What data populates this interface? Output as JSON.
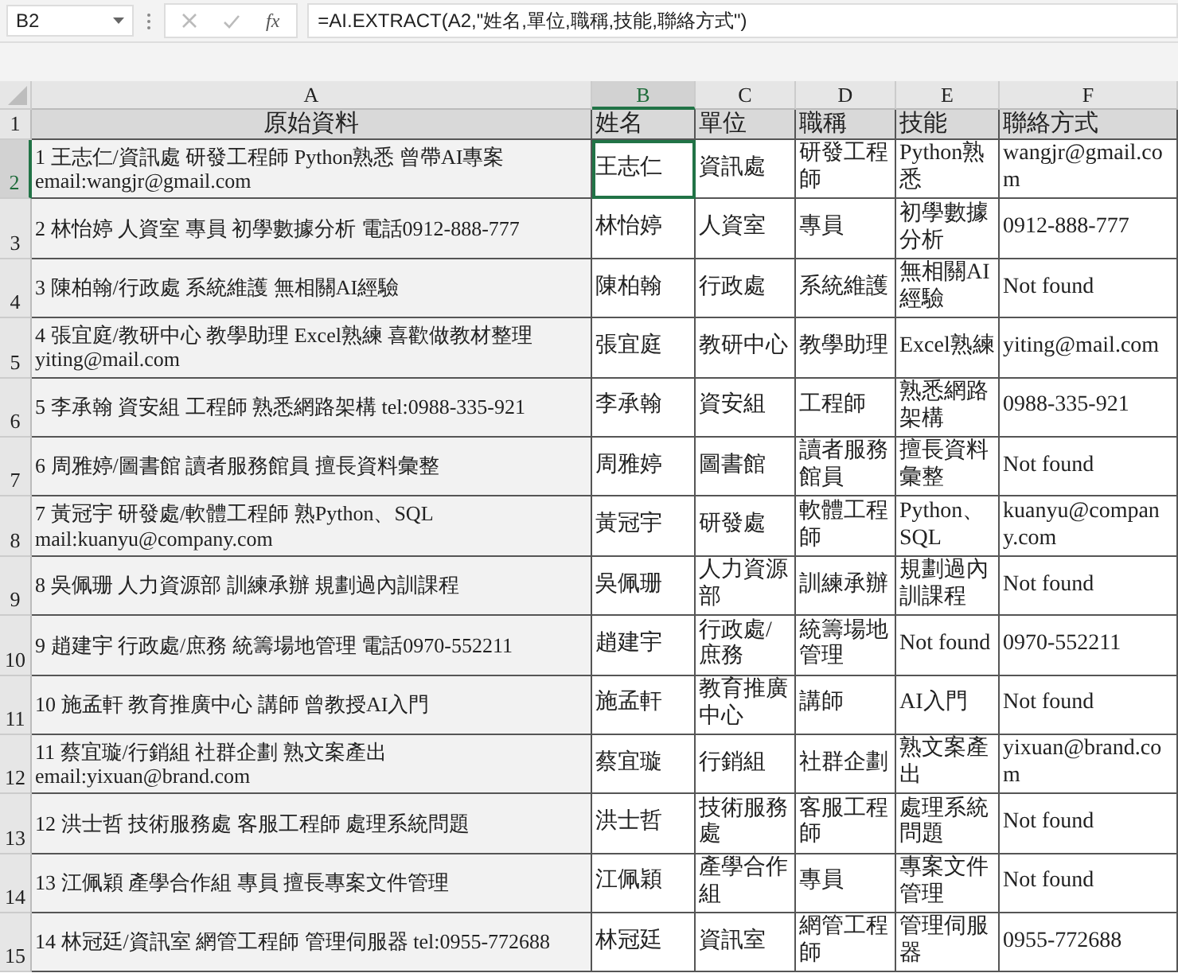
{
  "formula_bar": {
    "name_box": "B2",
    "function_label": "fx",
    "formula": "=AI.EXTRACT(A2,\"姓名,單位,職稱,技能,聯絡方式\")"
  },
  "columns": [
    {
      "label": "A",
      "selected": false
    },
    {
      "label": "B",
      "selected": true
    },
    {
      "label": "C",
      "selected": false
    },
    {
      "label": "D",
      "selected": false
    },
    {
      "label": "E",
      "selected": false
    },
    {
      "label": "F",
      "selected": false
    }
  ],
  "rows": [
    {
      "number": "1",
      "kind": "header",
      "selected": false,
      "cells": [
        "原始資料",
        "姓名",
        "單位",
        "職稱",
        "技能",
        "聯絡方式"
      ]
    },
    {
      "number": "2",
      "kind": "data",
      "selected": true,
      "cells": [
        "1 王志仁/資訊處 研發工程師 Python熟悉 曾帶AI專案 email:wangjr@gmail.com",
        "王志仁",
        "資訊處",
        "研發工程師",
        "Python熟悉",
        "wangjr@gmail.com"
      ]
    },
    {
      "number": "3",
      "kind": "data",
      "selected": false,
      "cells": [
        "2 林怡婷 人資室 專員 初學數據分析 電話0912-888-777",
        "林怡婷",
        "人資室",
        "專員",
        "初學數據分析",
        "0912-888-777"
      ]
    },
    {
      "number": "4",
      "kind": "data",
      "selected": false,
      "cells": [
        "3 陳柏翰/行政處 系統維護 無相關AI經驗",
        "陳柏翰",
        "行政處",
        "系統維護",
        "無相關AI經驗",
        "Not found"
      ]
    },
    {
      "number": "5",
      "kind": "data",
      "selected": false,
      "cells": [
        "4 張宜庭/教研中心 教學助理 Excel熟練 喜歡做教材整理 yiting@mail.com",
        "張宜庭",
        "教研中心",
        "教學助理",
        "Excel熟練",
        "yiting@mail.com"
      ]
    },
    {
      "number": "6",
      "kind": "data",
      "selected": false,
      "cells": [
        "5 李承翰 資安組 工程師 熟悉網路架構 tel:0988-335-921",
        "李承翰",
        "資安組",
        "工程師",
        "熟悉網路架構",
        "0988-335-921"
      ]
    },
    {
      "number": "7",
      "kind": "data",
      "selected": false,
      "cells": [
        "6 周雅婷/圖書館 讀者服務館員 擅長資料彙整",
        "周雅婷",
        "圖書館",
        "讀者服務館員",
        "擅長資料彙整",
        "Not found"
      ]
    },
    {
      "number": "8",
      "kind": "data",
      "selected": false,
      "cells": [
        "7 黃冠宇 研發處/軟體工程師 熟Python、SQL mail:kuanyu@company.com",
        "黃冠宇",
        "研發處",
        "軟體工程師",
        "Python、SQL",
        "kuanyu@company.com"
      ]
    },
    {
      "number": "9",
      "kind": "data",
      "selected": false,
      "cells": [
        "8 吳佩珊 人力資源部 訓練承辦 規劃過內訓課程",
        "吳佩珊",
        "人力資源部",
        "訓練承辦",
        "規劃過內訓課程",
        "Not found"
      ]
    },
    {
      "number": "10",
      "kind": "data",
      "selected": false,
      "cells": [
        "9 趙建宇 行政處/庶務 統籌場地管理 電話0970-552211",
        "趙建宇",
        "行政處/庶務",
        "統籌場地管理",
        "Not found",
        "0970-552211"
      ]
    },
    {
      "number": "11",
      "kind": "data",
      "selected": false,
      "cells": [
        "10 施孟軒 教育推廣中心 講師 曾教授AI入門",
        "施孟軒",
        "教育推廣中心",
        "講師",
        "AI入門",
        "Not found"
      ]
    },
    {
      "number": "12",
      "kind": "data",
      "selected": false,
      "cells": [
        "11 蔡宜璇/行銷組 社群企劃 熟文案產出 email:yixuan@brand.com",
        "蔡宜璇",
        "行銷組",
        "社群企劃",
        "熟文案產出",
        "yixuan@brand.com"
      ]
    },
    {
      "number": "13",
      "kind": "data",
      "selected": false,
      "cells": [
        "12 洪士哲 技術服務處 客服工程師 處理系統問題",
        "洪士哲",
        "技術服務處",
        "客服工程師",
        "處理系統問題",
        "Not found"
      ]
    },
    {
      "number": "14",
      "kind": "data",
      "selected": false,
      "cells": [
        "13 江佩穎 產學合作組 專員 擅長專案文件管理",
        "江佩穎",
        "產學合作組",
        "專員",
        "專案文件管理",
        "Not found"
      ]
    },
    {
      "number": "15",
      "kind": "data",
      "selected": false,
      "cells": [
        "14 林冠廷/資訊室 網管工程師 管理伺服器 tel:0955-772688",
        "林冠廷",
        "資訊室",
        "網管工程師",
        "管理伺服器",
        "0955-772688"
      ]
    }
  ]
}
